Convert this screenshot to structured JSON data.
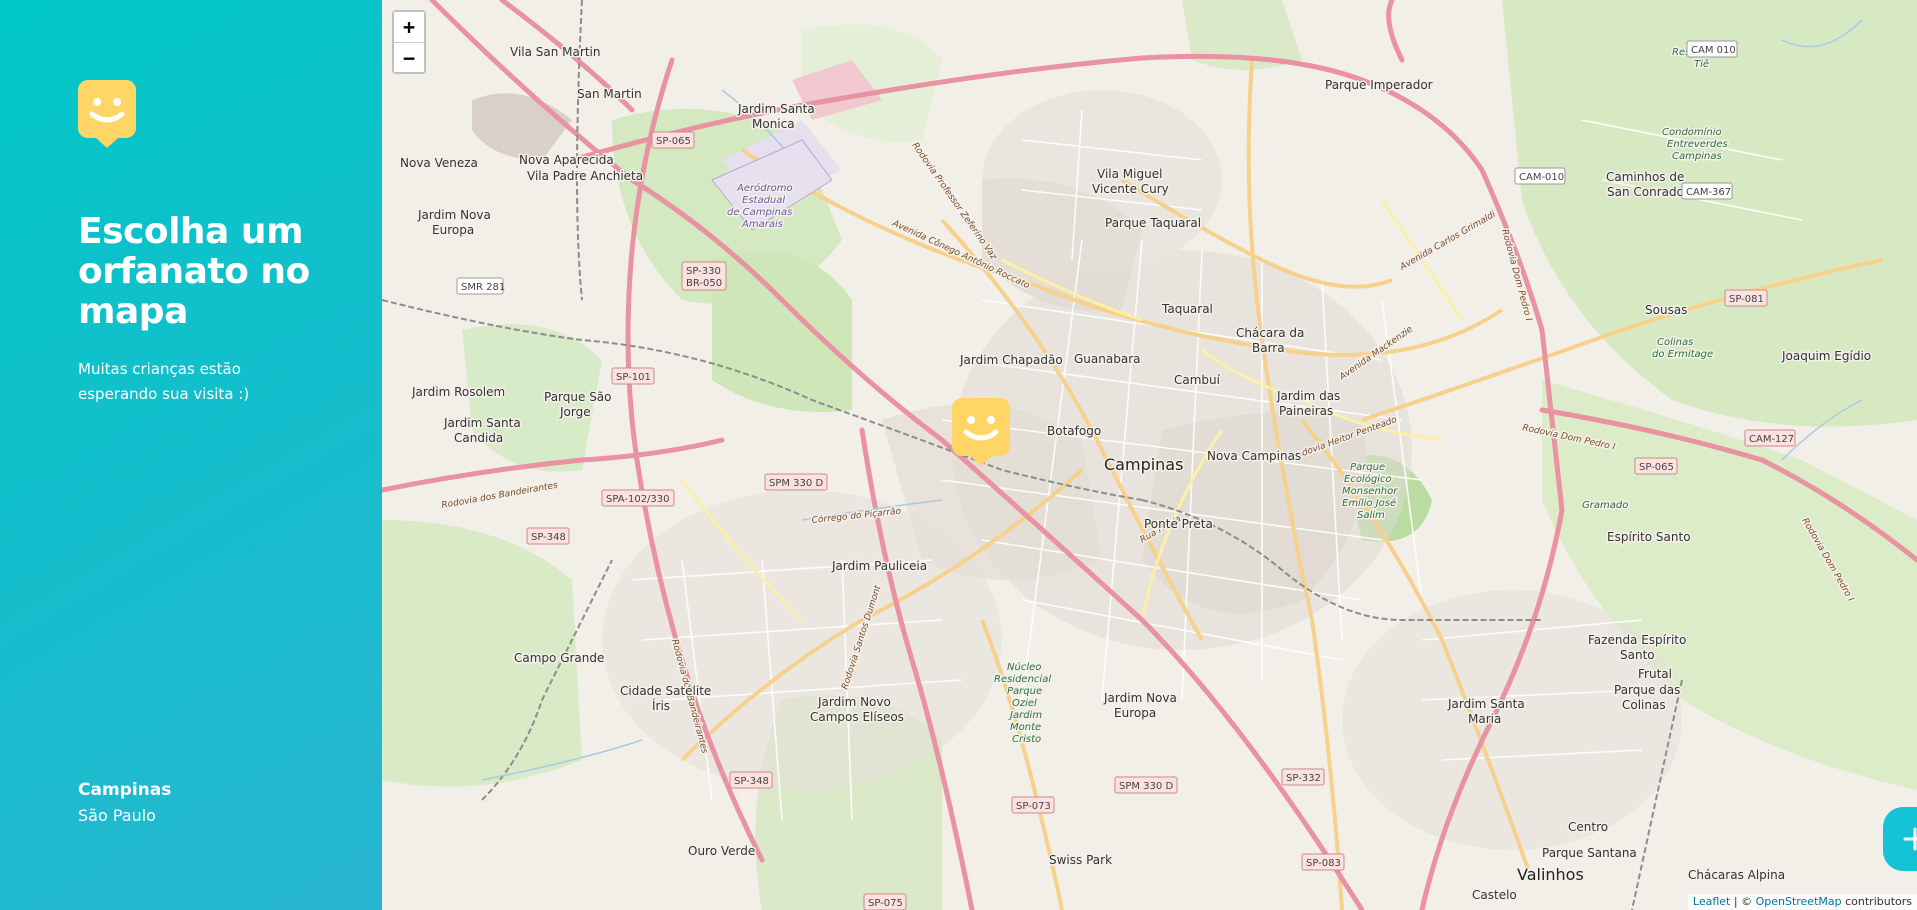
{
  "sidebar": {
    "logo_icon": "happy-face-icon",
    "headline": "Escolha um orfanato no mapa",
    "subtitle": "Muitas crianças estão esperando sua visita :)",
    "location": {
      "city": "Campinas",
      "state": "São Paulo"
    }
  },
  "map": {
    "zoom_in_label": "+",
    "zoom_out_label": "−",
    "marker_icon": "happy-face-marker-icon",
    "add_button_icon": "plus-icon",
    "attribution": {
      "leaflet": "Leaflet",
      "separator": " | © ",
      "osm": "OpenStreetMap",
      "suffix": " contributors"
    },
    "place_labels": [
      "Vila San Martin",
      "San Martin",
      "Jardim Santa Monica",
      "Parque Imperador",
      "Nova Veneza",
      "Nova Aparecida",
      "Vila Padre Anchieta",
      "Vila Miguel Vicente Cury",
      "Jardim Nova Europa",
      "Parque Taquaral",
      "Caminhos de San Conrado",
      "Taquaral",
      "Chácara da Barra",
      "Sousas",
      "Jardim Chapadão",
      "Guanabara",
      "Joaquim Egídio",
      "Jardim Rosolem",
      "Parque São Jorge",
      "Cambuí",
      "Jardim das Paineiras",
      "Jardim Santa Candida",
      "Botafogo",
      "Campinas",
      "Nova Campinas",
      "Ponte Preta",
      "Espírito Santo",
      "Jardim Pauliceia",
      "Campo Grande",
      "Fazenda Espírito Santo",
      "Frutal",
      "Parque das Colinas",
      "Cidade Satélite Íris",
      "Jardim Novo Campos Elíseos",
      "Jardim Nova Europa",
      "Jardim Santa Maria",
      "Centro",
      "Parque Santana",
      "Ouro Verde",
      "Swiss Park",
      "Valinhos",
      "Chácaras Alpina",
      "Castelo"
    ],
    "road_shields": [
      "SP-065",
      "SP-330 BR-050",
      "SMR 281",
      "SP-101",
      "SPM 330 D",
      "SPA-102/330",
      "SP-348",
      "SP-081",
      "CAM-010",
      "CAM 010",
      "CAM-367",
      "CAM-127",
      "SP-065",
      "SP-332",
      "SP-073",
      "SPM 330 D",
      "SP-083",
      "SP-075",
      "SP-348"
    ]
  },
  "colors": {
    "sidebar_gradient_start": "#29B6D1",
    "sidebar_gradient_end": "#00C7C7",
    "marker_yellow": "#FFD666",
    "add_button": "#15C3D6"
  }
}
